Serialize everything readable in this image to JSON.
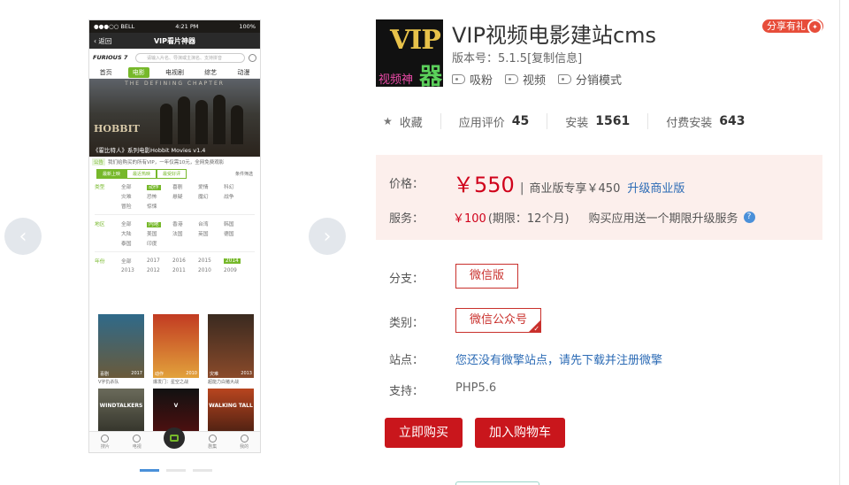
{
  "carousel": {
    "prev_icon": "chevron-left-icon",
    "next_icon": "chevron-right-icon",
    "dots": 3,
    "active_dot": 0
  },
  "phone": {
    "status": {
      "carrier": "●●●○○ BELL ",
      "time": "4:21 PM",
      "battery": "100%"
    },
    "back_label": "返回",
    "screen_title": "VIP看片神器",
    "logo": "FURIOUS 7",
    "search_placeholder": "请输入片名、导演或主演名、支持拼音",
    "tabs": [
      "首页",
      "电影",
      "电视剧",
      "综艺",
      "动漫"
    ],
    "active_tab": 1,
    "hero": {
      "top_text": "THE DEFINING CHAPTER",
      "title": "HOBBIT",
      "caption": "《霍比特人》系列电影Hobbit Movies v1.4"
    },
    "notice": {
      "tag": "公告",
      "text": "我们给购买的所有VIP，一年仅需10元，全网免费观影"
    },
    "sort": [
      "最新上映",
      "最近热映",
      "最受好评"
    ],
    "sort_cond": "条件筛选",
    "filters": {
      "type": {
        "label": "类型",
        "options": [
          "全部",
          "动作",
          "喜剧",
          "爱情",
          "科幻",
          "灾难",
          "恐怖",
          "悬疑",
          "魔幻",
          "战争",
          "冒险",
          "惊悚"
        ],
        "active": "动作"
      },
      "region": {
        "label": "地区",
        "options": [
          "全部",
          "内地",
          "香港",
          "台湾",
          "韩国",
          "大陆",
          "美国",
          "法国",
          "英国",
          "德国",
          "泰国",
          "印度"
        ],
        "active": "内地"
      },
      "year": {
        "label": "年份",
        "options": [
          "全部",
          "2017",
          "2016",
          "2015",
          "2014",
          "2013",
          "2012",
          "2011",
          "2010",
          "2009"
        ],
        "active": "2014"
      }
    },
    "posters": [
      {
        "genre": "喜剧",
        "year": "2017",
        "caption": "V字仇杀队",
        "colors": [
          "#2f6a8a",
          "#6a5a3a"
        ]
      },
      {
        "genre": "动作",
        "year": "2010",
        "caption": "爆发门：星空之战",
        "colors": [
          "#c23b22",
          "#e2a23b"
        ]
      },
      {
        "genre": "灾难",
        "year": "2013",
        "caption": "超能力白猪大战",
        "colors": [
          "#3a2a20",
          "#8a4a2a"
        ]
      }
    ],
    "posters_row2": [
      {
        "title": "WINDTALKERS",
        "colors": [
          "#6a6a5a",
          "#2a2a22"
        ]
      },
      {
        "title": "V",
        "colors": [
          "#111",
          "#5a1010"
        ]
      },
      {
        "title": "WALKING TALL",
        "colors": [
          "#b8451f",
          "#3a1a10"
        ]
      }
    ],
    "bottom": [
      "搜片",
      "电视",
      "",
      "剧集",
      "我的"
    ]
  },
  "app": {
    "icon_text": {
      "vip": "VIP",
      "cn1": "视频神",
      "cn2": "器"
    },
    "title": "VIP视频电影建站cms",
    "version": "版本号：5.1.5[复制信息]",
    "tags": [
      "吸粉",
      "视频",
      "分销模式"
    ],
    "share_label": "分享有礼",
    "stats": {
      "favorite_label": "收藏",
      "rating_label": "应用评价",
      "rating_value": "45",
      "install_label": "安装",
      "install_value": "1561",
      "paid_label": "付费安装",
      "paid_value": "643"
    },
    "price": {
      "label": "价格：",
      "value": "￥550",
      "biz_text": "商业版专享￥450",
      "upgrade_label": "升级商业版"
    },
    "service": {
      "label": "服务：",
      "price": "￥100",
      "period": "(期限：12个月)",
      "desc": "购买应用送一个期限升级服务"
    },
    "branch": {
      "label": "分支：",
      "option": "微信版"
    },
    "category": {
      "label": "类别：",
      "option": "微信公众号"
    },
    "site": {
      "label": "站点：",
      "text": "您还没有微擎站点，请先下载并注册微擎"
    },
    "support": {
      "label": "支持：",
      "value": "PHP5.6"
    },
    "buy_label": "立即购买",
    "cart_label": "加入购物车"
  },
  "colors": {
    "accent": "#c9161c",
    "link": "#2c6bb5",
    "price_bg": "#fcefec",
    "phone_green": "#76b82a"
  }
}
